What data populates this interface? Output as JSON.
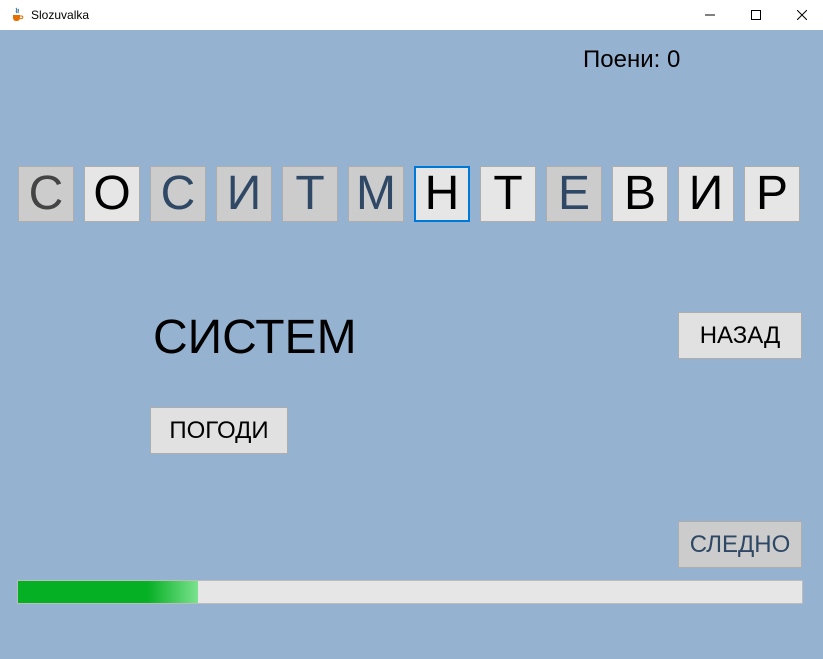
{
  "window": {
    "title": "Slozuvalka",
    "icon": "java-coffee-cup-icon",
    "controls": [
      "minimize-icon",
      "maximize-icon",
      "close-icon"
    ]
  },
  "score": {
    "label": "Поени: 0"
  },
  "letters": [
    {
      "char": "С",
      "state": "dim"
    },
    {
      "char": "О",
      "state": "light"
    },
    {
      "char": "С",
      "state": "dim"
    },
    {
      "char": "И",
      "state": "dim"
    },
    {
      "char": "Т",
      "state": "dim"
    },
    {
      "char": "М",
      "state": "dim"
    },
    {
      "char": "Н",
      "state": "focused"
    },
    {
      "char": "Т",
      "state": "light"
    },
    {
      "char": "Е",
      "state": "dim"
    },
    {
      "char": "В",
      "state": "light"
    },
    {
      "char": "И",
      "state": "light"
    },
    {
      "char": "Р",
      "state": "light"
    }
  ],
  "current_word": "СИСТЕМ",
  "buttons": {
    "back": "НАЗАД",
    "guess": "ПОГОДИ",
    "next": "СЛЕДНО"
  },
  "progress": {
    "fraction": 0.23
  },
  "colors": {
    "background": "#96b2d1",
    "progress_fill": "#06b025",
    "focus_border": "#0078d7"
  }
}
